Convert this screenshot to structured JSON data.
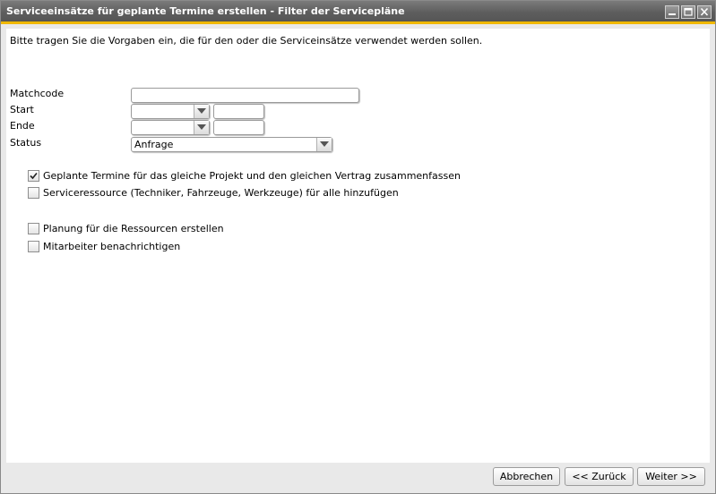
{
  "window": {
    "title": "Serviceeinsätze für geplante Termine erstellen - Filter der Servicepläne",
    "accent_color": "#f0b800",
    "controls": [
      "minimize-icon",
      "maximize-icon",
      "close-icon"
    ]
  },
  "intro_text": "Bitte tragen Sie die Vorgaben ein, die für den oder die Serviceinsätze verwendet werden sollen.",
  "form": {
    "matchcode": {
      "label": "Matchcode",
      "value": ""
    },
    "start": {
      "label": "Start",
      "date_value": "",
      "time_value": ""
    },
    "ende": {
      "label": "Ende",
      "date_value": "",
      "time_value": ""
    },
    "status": {
      "label": "Status",
      "value": "Anfrage"
    }
  },
  "options": [
    {
      "label": "Geplante Termine für das gleiche Projekt und den gleichen Vertrag zusammenfassen",
      "checked": true
    },
    {
      "label": "Serviceressource (Techniker, Fahrzeuge, Werkzeuge) für alle hinzufügen",
      "checked": false
    },
    {
      "label": "Planung für die Ressourcen erstellen",
      "checked": false
    },
    {
      "label": "Mitarbeiter benachrichtigen",
      "checked": false
    }
  ],
  "buttons": {
    "cancel": "Abbrechen",
    "back": "<< Zurück",
    "next": "Weiter >>"
  }
}
